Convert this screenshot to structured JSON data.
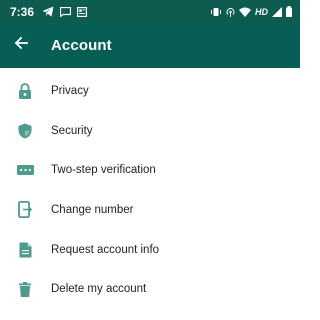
{
  "status_bar": {
    "time": "7:36",
    "network_type": "HD",
    "left_icons": [
      "telegram-icon",
      "message-icon",
      "news-icon"
    ],
    "right_icons": [
      "vibrate-icon",
      "hotspot-icon",
      "wifi-icon",
      "signal-icon",
      "battery-icon"
    ]
  },
  "app_bar": {
    "title": "Account",
    "back_icon": "arrow-left-icon"
  },
  "menu": [
    {
      "label": "Privacy",
      "icon": "lock-icon"
    },
    {
      "label": "Security",
      "icon": "shield-icon"
    },
    {
      "label": "Two-step verification",
      "icon": "dots-icon"
    },
    {
      "label": "Change number",
      "icon": "phone-swap-icon"
    },
    {
      "label": "Request account info",
      "icon": "document-icon"
    },
    {
      "label": "Delete my account",
      "icon": "trash-icon"
    }
  ],
  "colors": {
    "status_bar_bg": "#0d5c4f",
    "app_bar_bg": "#075e54",
    "icon_color": "#4e9a8c",
    "text_color": "#1f1f1f"
  }
}
